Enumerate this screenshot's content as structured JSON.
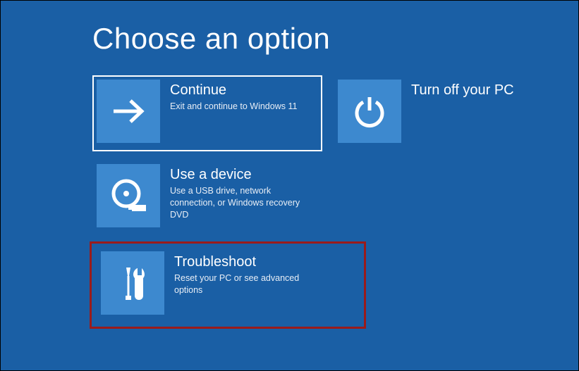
{
  "title": "Choose an option",
  "options": {
    "continue": {
      "title": "Continue",
      "desc": "Exit and continue to Windows 11"
    },
    "turnoff": {
      "title": "Turn off your PC",
      "desc": ""
    },
    "usedevice": {
      "title": "Use a device",
      "desc": "Use a USB drive, network connection, or Windows recovery DVD"
    },
    "troubleshoot": {
      "title": "Troubleshoot",
      "desc": "Reset your PC or see advanced options"
    }
  }
}
